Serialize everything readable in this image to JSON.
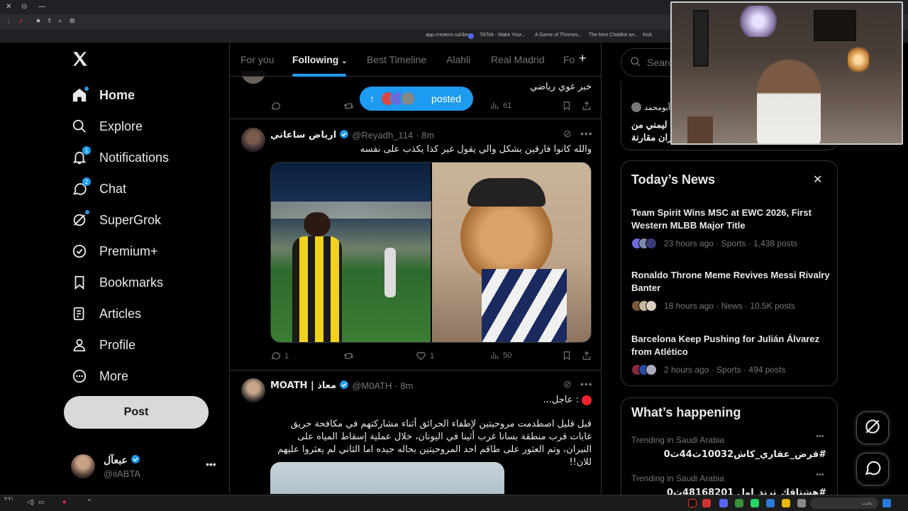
{
  "browser": {
    "url_hint": "",
    "bookmarks": [
      "app.creators.sa/das...",
      "TikTok - Make Your...",
      "A Game of Thrones...",
      "The best ChatBot an...",
      "Kick"
    ]
  },
  "sidebar": {
    "items": [
      {
        "label": "Home",
        "icon": "home-icon"
      },
      {
        "label": "Explore",
        "icon": "search-icon"
      },
      {
        "label": "Notifications",
        "icon": "bell-icon",
        "badge": "1"
      },
      {
        "label": "Chat",
        "icon": "chat-icon",
        "badge": "2"
      },
      {
        "label": "SuperGrok",
        "icon": "grok-icon"
      },
      {
        "label": "Premium+",
        "icon": "verified-icon"
      },
      {
        "label": "Bookmarks",
        "icon": "bookmark-icon"
      },
      {
        "label": "Articles",
        "icon": "article-icon"
      },
      {
        "label": "Profile",
        "icon": "person-icon"
      },
      {
        "label": "More",
        "icon": "more-circle-icon"
      }
    ],
    "post_label": "Post",
    "account": {
      "name": "عبعآل",
      "handle": "@iiABTA"
    }
  },
  "feed": {
    "tabs": [
      "For you",
      "Following",
      "Best Timeline",
      "Alahli",
      "Real Madrid",
      "Fo"
    ],
    "posted_label": "posted",
    "tweet0": {
      "text": "خبر غوي رياضي",
      "views": "61"
    },
    "tweet1": {
      "name": "ارياض ساعاتي",
      "handle": "@Reyadh_114",
      "time": "· 8m",
      "text": "والله كانوا فارقين بشكل والي يقول غير كذا يكذب على نفسه",
      "replies": "1",
      "likes": "1",
      "views": "50"
    },
    "tweet2": {
      "name": "MOATH | معاذ",
      "handle": "@M0ATH",
      "time": "· 8m",
      "line1": ": عاجل...",
      "text": "قبل قليل اصطدمت مروحيتين لإطفاء الحرائق أثناء مشاركتهم في مكافحة حريق غابات قرب منطقة بسانا غرب أثينا في اليونان، خلال عملية إسقاط المياه على النيران، وتم العثور على طاقم احد المروحيتين بحاله جيده اما الثاني لم يعثروا عليهم للان!!"
    }
  },
  "right": {
    "search_placeholder": "Search",
    "top_card": {
      "line_a": "أبومحمد",
      "line_b": "ليمني من",
      "line_c": "ران مقارنة"
    },
    "todays_news": {
      "title": "Today’s News",
      "items": [
        {
          "headline": "Team Spirit Wins MSC at EWC 2026, First Western MLBB Major Title",
          "meta": "23 hours ago · Sports · 1,438 posts"
        },
        {
          "headline": "Ronaldo Throne Meme Revives Messi Rivalry Banter",
          "meta": "18 hours ago · News · 10.5K posts"
        },
        {
          "headline": "Barcelona Keep Pushing for Julián Álvarez from Atlético",
          "meta": "2 hours ago · Sports · 494 posts"
        }
      ]
    },
    "whats_happening": {
      "title": "What’s happening",
      "trends": [
        {
          "label": "Trending in Saudi Arabia",
          "topic": "#قرض_عقاري_كاش10032ث44ث0"
        },
        {
          "label": "Trending in Saudi Arabia",
          "topic": "#هشتاقك_ترند_اول 48168201ث0"
        }
      ]
    }
  },
  "taskbar": {
    "clock": "٢:٢١",
    "search_placeholder": "بحث"
  },
  "colors": {
    "accent": "#1d9bf0",
    "bg": "#000000",
    "border": "#2f3336",
    "muted": "#71767b"
  }
}
